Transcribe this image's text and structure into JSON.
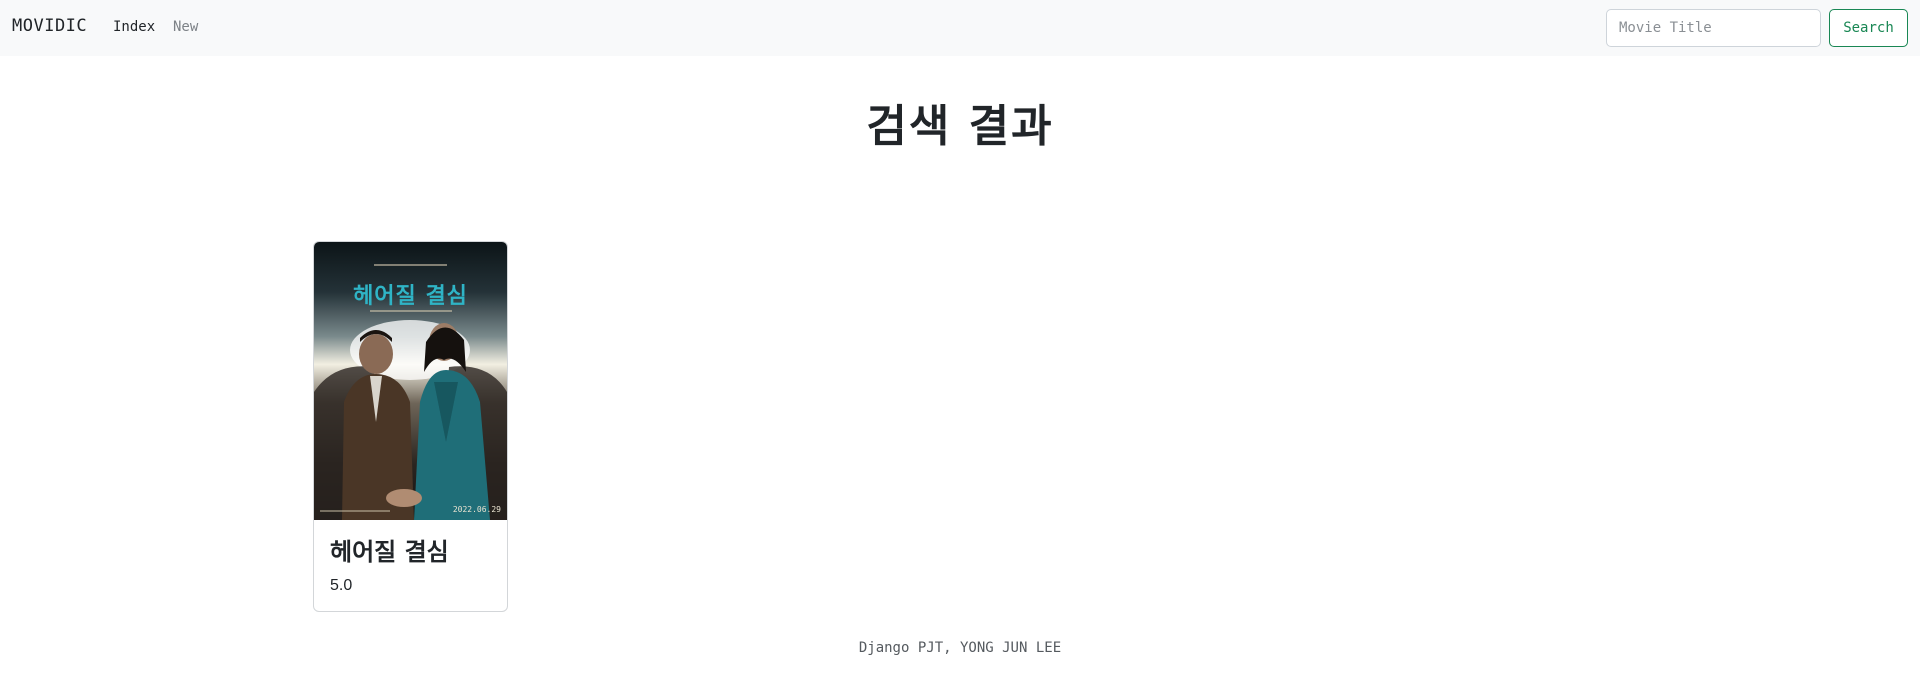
{
  "navbar": {
    "brand": "MOVIDIC",
    "links": [
      {
        "label": "Index"
      },
      {
        "label": "New"
      }
    ],
    "search": {
      "placeholder": "Movie Title",
      "value": "",
      "button_label": "Search"
    }
  },
  "main": {
    "title": "검색 결과",
    "results": [
      {
        "title": "헤어질 결심",
        "rating": "5.0",
        "poster": {
          "title": "헤어질 결심",
          "date": "2022.06.29"
        }
      }
    ]
  },
  "footer": {
    "text": "Django PJT, YONG JUN LEE"
  },
  "colors": {
    "navbar_bg": "#f8f9fa",
    "accent_success": "#198754",
    "poster_title": "#2fb4c6"
  }
}
